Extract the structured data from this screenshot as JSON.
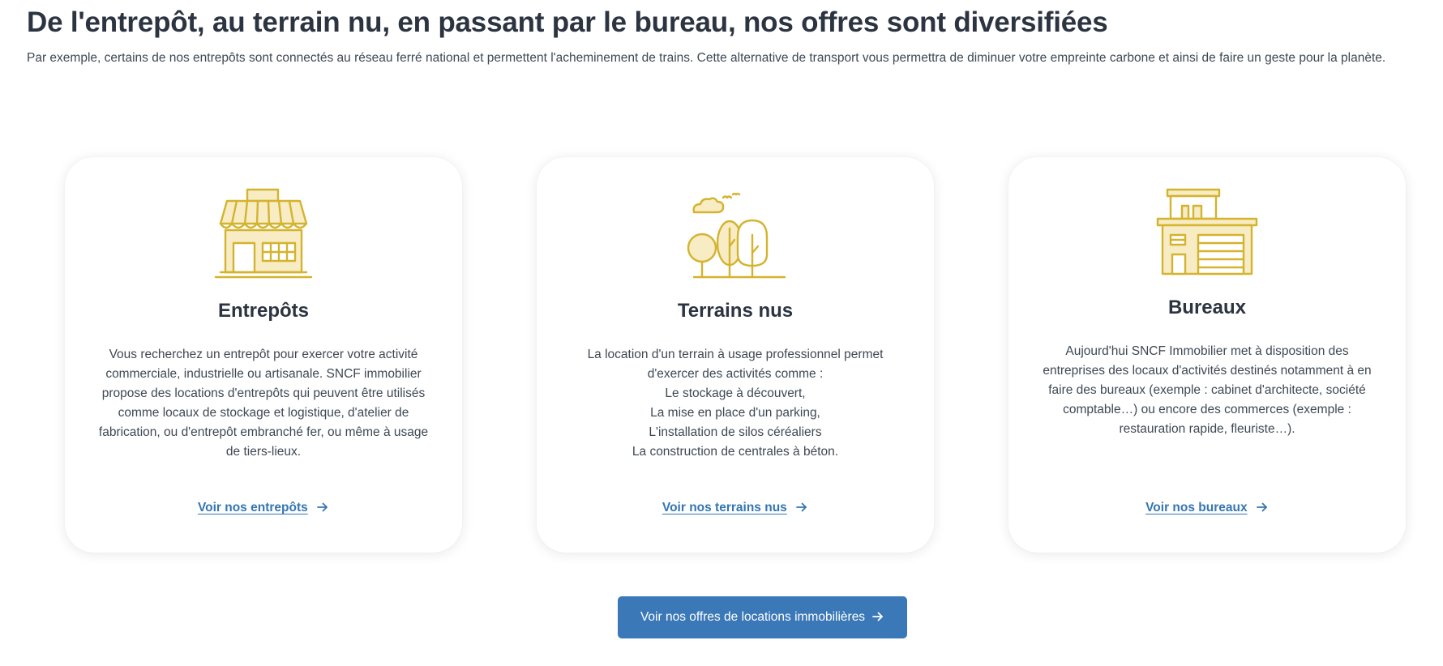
{
  "header": {
    "title": "De l'entrepôt, au terrain nu, en passant par le bureau, nos offres sont diversifiées",
    "intro": "Par exemple, certains de nos entrepôts sont connectés au réseau ferré national et permettent l'acheminement de trains.  Cette alternative de transport vous permettra de diminuer votre empreinte carbone et ainsi de faire un geste pour la planète."
  },
  "cards": [
    {
      "icon": "storefront-icon",
      "title": "Entrepôts",
      "text": "Vous recherchez un entrepôt pour exercer votre activité commerciale, industrielle ou artisanale.  SNCF immobilier propose des locations d'entrepôts qui peuvent être utilisés comme locaux de stockage et logistique, d'atelier de fabrication, ou d'entrepôt embranché fer, ou même à usage de tiers-lieux.",
      "link": "Voir nos entrepôts"
    },
    {
      "icon": "trees-icon",
      "title": "Terrains nus",
      "text_lines": [
        "La location d'un terrain à usage professionnel permet d'exercer des activités comme :",
        "Le stockage à découvert,",
        "La mise en place d'un parking,",
        "L'installation de silos céréaliers",
        "La construction de centrales à béton."
      ],
      "link": "Voir nos terrains nus"
    },
    {
      "icon": "office-building-icon",
      "title": "Bureaux",
      "text": "Aujourd'hui SNCF Immobilier met à disposition des entreprises des locaux d'activités destinés notamment à en faire des bureaux (exemple : cabinet d'architecte, société comptable…) ou encore des commerces (exemple : restauration rapide, fleuriste…).",
      "link": "Voir nos bureaux"
    }
  ],
  "cta": {
    "label": "Voir nos offres de locations immobilières"
  },
  "colors": {
    "heading": "#2b3440",
    "body_text": "#3e4853",
    "link": "#3476b1",
    "button_bg": "#3a78b7",
    "icon_stroke": "#d4b32e",
    "icon_fill": "#f7ecc4"
  }
}
